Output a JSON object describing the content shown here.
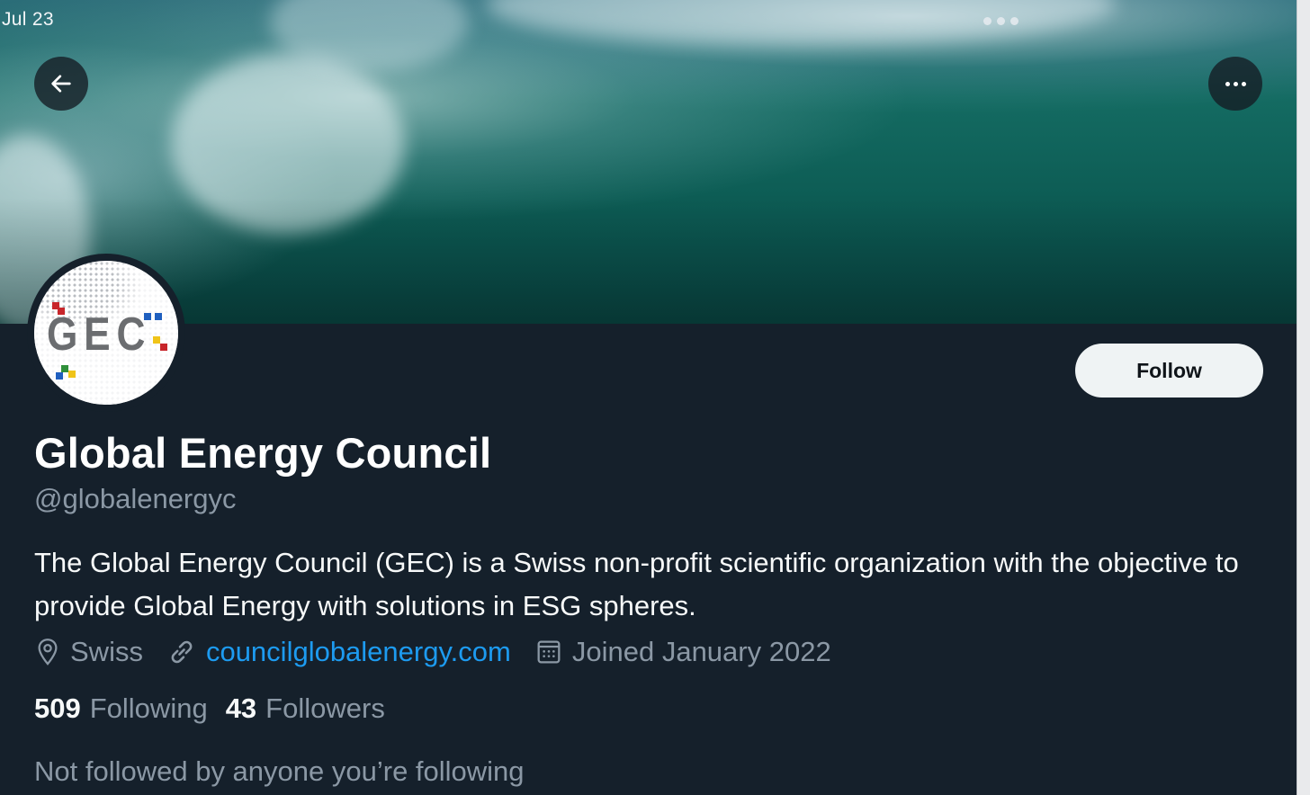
{
  "status": {
    "date": "Jul 23"
  },
  "header": {
    "back_icon": "arrow-left-icon",
    "more_icon": "more-horizontal-icon"
  },
  "banner": {
    "description_icon": "ocean-wave-banner"
  },
  "profile": {
    "avatar_text": "GEC",
    "name": "Global Energy Council",
    "handle": "@globalenergyc",
    "bio": "The Global Energy Council (GEC) is a Swiss non-profit scientific organization with the objective to provide Global Energy with solutions in ESG spheres.",
    "follow_label": "Follow",
    "location": "Swiss",
    "website": "councilglobalenergy.com",
    "joined": "Joined January 2022",
    "following_count": "509",
    "following_label": "Following",
    "followers_count": "43",
    "followers_label": "Followers",
    "not_followed_text": "Not followed by anyone you’re following"
  },
  "colors": {
    "background": "#15202b",
    "link": "#1d9bf0",
    "secondary_text": "#8b98a5",
    "follow_button_bg": "#eff3f4"
  }
}
